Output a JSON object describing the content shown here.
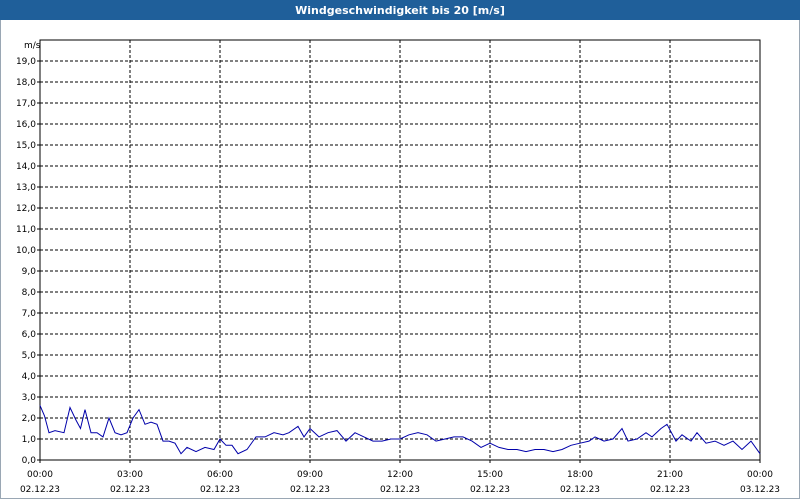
{
  "window": {
    "title": "Windgeschwindigkeit bis 20 [m/s]"
  },
  "chart_data": {
    "type": "line",
    "title": "Windgeschwindigkeit bis 20 [m/s]",
    "ylabel": "m/s",
    "xlabel": "",
    "ylim": [
      0,
      20
    ],
    "xlim_hours": [
      0,
      24
    ],
    "grid": true,
    "colors": {
      "line": "#0000aa",
      "grid": "#000000",
      "axis": "#000000"
    },
    "y_ticks": [
      "0,0",
      "1,0",
      "2,0",
      "3,0",
      "4,0",
      "5,0",
      "6,0",
      "7,0",
      "8,0",
      "9,0",
      "10,0",
      "11,0",
      "12,0",
      "13,0",
      "14,0",
      "15,0",
      "16,0",
      "17,0",
      "18,0",
      "19,0"
    ],
    "x_ticks": [
      {
        "time": "00:00",
        "date": "02.12.23"
      },
      {
        "time": "03:00",
        "date": "02.12.23"
      },
      {
        "time": "06:00",
        "date": "02.12.23"
      },
      {
        "time": "09:00",
        "date": "02.12.23"
      },
      {
        "time": "12:00",
        "date": "02.12.23"
      },
      {
        "time": "15:00",
        "date": "02.12.23"
      },
      {
        "time": "18:00",
        "date": "02.12.23"
      },
      {
        "time": "21:00",
        "date": "02.12.23"
      },
      {
        "time": "00:00",
        "date": "03.12.23"
      }
    ],
    "series": [
      {
        "x_hours": [
          0,
          0.15,
          0.3,
          0.5,
          0.8,
          1.0,
          1.2,
          1.35,
          1.5,
          1.7,
          1.9,
          2.1,
          2.3,
          2.5,
          2.7,
          2.9,
          3.1,
          3.3,
          3.5,
          3.7,
          3.9,
          4.1,
          4.3,
          4.5,
          4.7,
          4.9,
          5.2,
          5.5,
          5.8,
          6.0,
          6.2,
          6.4,
          6.6,
          6.9,
          7.2,
          7.5,
          7.8,
          8.1,
          8.3,
          8.6,
          8.8,
          9.0,
          9.3,
          9.6,
          9.9,
          10.2,
          10.5,
          10.8,
          11.1,
          11.4,
          11.7,
          12.0,
          12.3,
          12.6,
          12.9,
          13.2,
          13.5,
          13.8,
          14.1,
          14.4,
          14.7,
          15.0,
          15.3,
          15.6,
          15.9,
          16.2,
          16.5,
          16.8,
          17.1,
          17.4,
          17.7,
          18.0,
          18.3,
          18.5,
          18.8,
          19.1,
          19.4,
          19.6,
          19.9,
          20.2,
          20.4,
          20.7,
          20.9,
          21.2,
          21.4,
          21.7,
          21.9,
          22.2,
          22.5,
          22.8,
          23.1,
          23.4,
          23.7,
          24.0
        ],
        "values": [
          2.6,
          2.1,
          1.3,
          1.4,
          1.3,
          2.5,
          1.9,
          1.5,
          2.4,
          1.3,
          1.3,
          1.1,
          2.0,
          1.3,
          1.2,
          1.3,
          2.0,
          2.4,
          1.7,
          1.8,
          1.7,
          0.9,
          0.9,
          0.8,
          0.3,
          0.6,
          0.4,
          0.6,
          0.5,
          1.0,
          0.7,
          0.7,
          0.3,
          0.5,
          1.1,
          1.1,
          1.3,
          1.2,
          1.3,
          1.6,
          1.1,
          1.5,
          1.1,
          1.3,
          1.4,
          0.9,
          1.3,
          1.1,
          0.9,
          0.9,
          1.0,
          1.0,
          1.2,
          1.3,
          1.2,
          0.9,
          1.0,
          1.1,
          1.1,
          0.9,
          0.6,
          0.8,
          0.6,
          0.5,
          0.5,
          0.4,
          0.5,
          0.5,
          0.4,
          0.5,
          0.7,
          0.8,
          0.9,
          1.1,
          0.9,
          1.0,
          1.5,
          0.9,
          1.0,
          1.3,
          1.1,
          1.5,
          1.7,
          0.9,
          1.2,
          0.9,
          1.3,
          0.8,
          0.9,
          0.7,
          0.9,
          0.5,
          0.9,
          0.3
        ]
      }
    ]
  }
}
